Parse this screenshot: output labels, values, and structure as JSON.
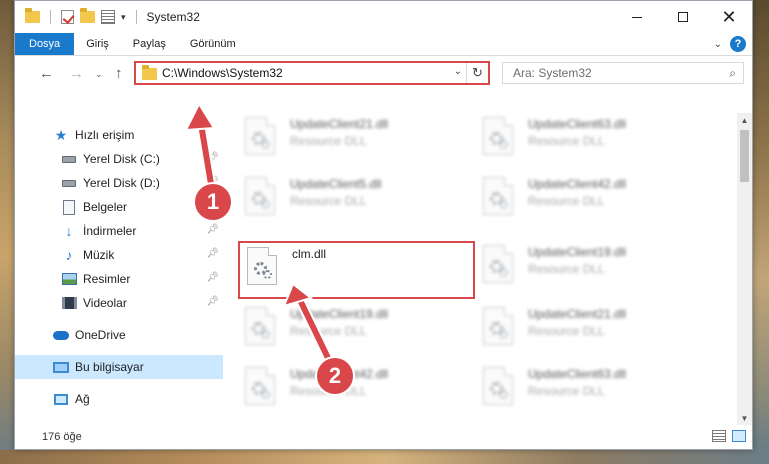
{
  "window": {
    "title": "System32"
  },
  "ribbon": {
    "tabs": [
      {
        "label": "Dosya",
        "active": true
      },
      {
        "label": "Giriş"
      },
      {
        "label": "Paylaş"
      },
      {
        "label": "Görünüm"
      }
    ],
    "help_label": "?"
  },
  "nav": {
    "address": "C:\\Windows\\System32",
    "search_placeholder": "Ara: System32"
  },
  "sidebar": {
    "items": [
      {
        "label": "Hızlı erişim",
        "icon": "star-icon"
      },
      {
        "label": "Yerel Disk (C:)",
        "icon": "drive-icon",
        "pinned": true
      },
      {
        "label": "Yerel Disk (D:)",
        "icon": "drive-icon",
        "pinned": true
      },
      {
        "label": "Belgeler",
        "icon": "document-icon",
        "pinned": true
      },
      {
        "label": "İndirmeler",
        "icon": "download-icon",
        "pinned": true
      },
      {
        "label": "Müzik",
        "icon": "music-icon",
        "pinned": true
      },
      {
        "label": "Resimler",
        "icon": "pictures-icon",
        "pinned": true
      },
      {
        "label": "Videolar",
        "icon": "videos-icon",
        "pinned": true
      },
      {
        "label": "OneDrive",
        "icon": "onedrive-icon"
      },
      {
        "label": "Bu bilgisayar",
        "icon": "this-pc-icon",
        "selected": true
      },
      {
        "label": "Ağ",
        "icon": "network-icon"
      }
    ]
  },
  "files": {
    "left": [
      {
        "name": "UpdateClient21.dll",
        "desc": "Resource DLL",
        "blurred": true
      },
      {
        "name": "UpdateClient5.dll",
        "desc": "Resource DLL",
        "blurred": true
      },
      {
        "name": "clm.dll",
        "desc": "",
        "blurred": false,
        "highlighted": true
      },
      {
        "name": "UpdateClient19.dll",
        "desc": "Resource DLL",
        "blurred": true
      },
      {
        "name": "UpdateClient42.dll",
        "desc": "Resource DLL",
        "blurred": true
      }
    ],
    "right": [
      {
        "name": "UpdateClient63.dll",
        "desc": "Resource DLL",
        "blurred": true
      },
      {
        "name": "UpdateClient42.dll",
        "desc": "Resource DLL",
        "blurred": true
      },
      {
        "name": "UpdateClient19.dll",
        "desc": "Resource DLL",
        "blurred": true
      },
      {
        "name": "UpdateClient21.dll",
        "desc": "Resource DLL",
        "blurred": true
      },
      {
        "name": "UpdateClient63.dll",
        "desc": "Resource DLL",
        "blurred": true
      }
    ]
  },
  "status": {
    "item_count": "176 öğe"
  },
  "annotations": {
    "step1": "1",
    "step2": "2",
    "color": "#d9474b"
  },
  "colors": {
    "accent": "#1979ca",
    "selected_bg": "#cce8ff",
    "highlight": "#d9474b"
  }
}
